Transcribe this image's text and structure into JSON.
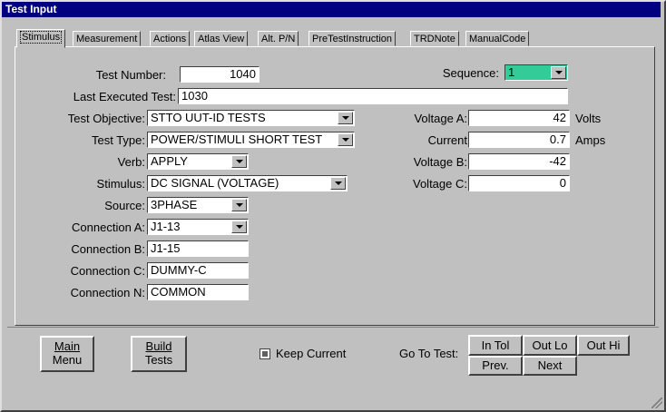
{
  "window": {
    "title": "Test Input"
  },
  "tabs": [
    "Stimulus",
    "Measurement",
    "Actions",
    "Atlas View",
    "Alt. P/N",
    "PreTestInstruction",
    "TRDNote",
    "ManualCode"
  ],
  "form": {
    "test_number_label": "Test Number:",
    "test_number": "1040",
    "sequence_label": "Sequence:",
    "sequence_value": "1",
    "last_executed_label": "Last Executed Test:",
    "last_executed": "1030",
    "test_objective_label": "Test Objective:",
    "test_objective": "STTO UUT-ID TESTS",
    "test_type_label": "Test Type:",
    "test_type": "POWER/STIMULI SHORT TEST",
    "verb_label": "Verb:",
    "verb": "APPLY",
    "stimulus_label": "Stimulus:",
    "stimulus": "DC SIGNAL (VOLTAGE)",
    "source_label": "Source:",
    "source": "3PHASE",
    "conn_a_label": "Connection A:",
    "conn_a": "J1-13",
    "conn_b_label": "Connection B:",
    "conn_b": "J1-15",
    "conn_c_label": "Connection C:",
    "conn_c": "DUMMY-C",
    "conn_n_label": "Connection N:",
    "conn_n": "COMMON",
    "voltage_a_label": "Voltage A:",
    "voltage_a": "42",
    "voltage_a_unit": "Volts",
    "current_label": "Current",
    "current": "0.7",
    "current_unit": "Amps",
    "voltage_b_label": "Voltage B:",
    "voltage_b": "-42",
    "voltage_c_label": "Voltage C:",
    "voltage_c": "0"
  },
  "bottom": {
    "main_menu": [
      "Main",
      "Menu"
    ],
    "build_tests": [
      "Build",
      "Tests"
    ],
    "keep_current": "Keep Current",
    "goto_label": "Go To Test:",
    "in_tol": "In Tol",
    "out_lo": "Out Lo",
    "out_hi": "Out Hi",
    "prev": "Prev.",
    "next": "Next"
  },
  "colors": {
    "title_bar": "#000080",
    "sequence_bg": "#33cc99",
    "face": "#c0c0c0"
  }
}
